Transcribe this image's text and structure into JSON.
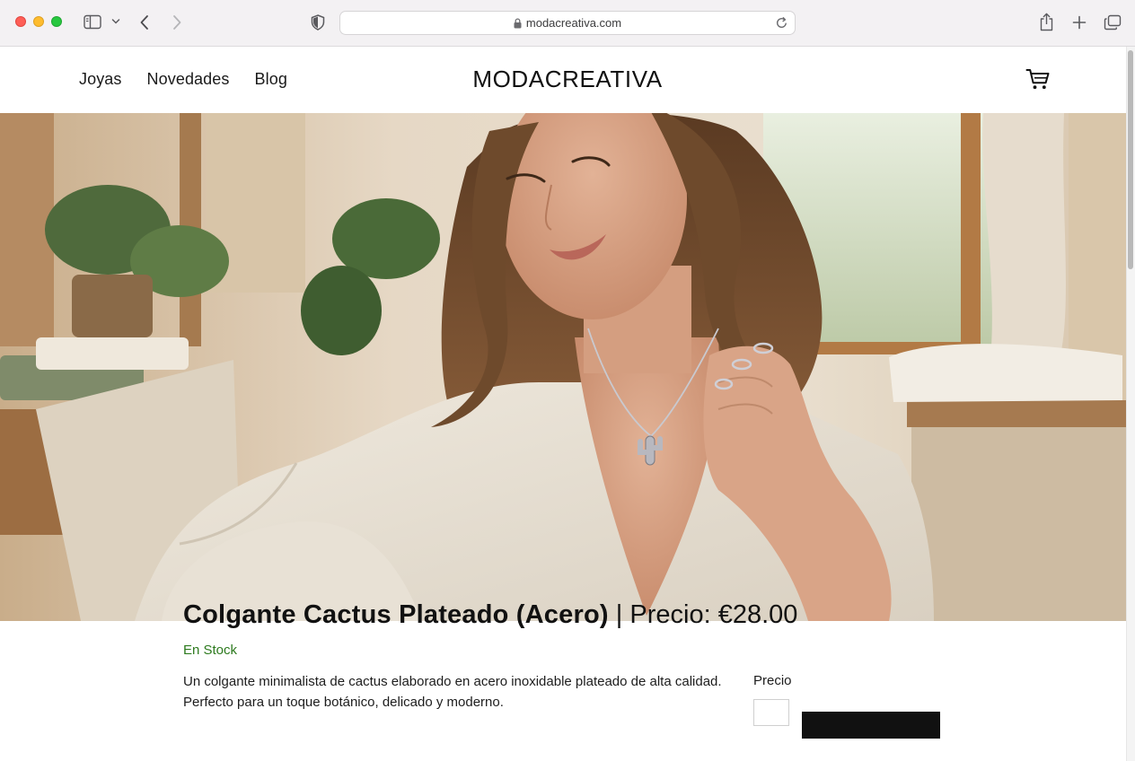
{
  "browser": {
    "url": "modacreativa.com"
  },
  "site": {
    "logo": "MODACREATIVA",
    "nav": [
      {
        "label": "Joyas"
      },
      {
        "label": "Novedades"
      },
      {
        "label": "Blog"
      }
    ]
  },
  "product": {
    "name": "Colgante Cactus Plateado (Acero)",
    "separator": "|",
    "price_text": "Precio: €28.00",
    "stock": "En Stock",
    "description_line1": "Un colgante minimalista de cactus elaborado en acero inoxidable plateado de alta calidad.",
    "description_line2": "Perfecto para un toque botánico, delicado y moderno.",
    "price_label": "Precio"
  },
  "colors": {
    "stock_green": "#2d7a1e",
    "button_dark": "#111111"
  },
  "icons": {
    "cart": "shopping-cart-icon",
    "share": "share-icon",
    "new_tab": "plus-icon",
    "tabs": "tabs-overview-icon"
  }
}
